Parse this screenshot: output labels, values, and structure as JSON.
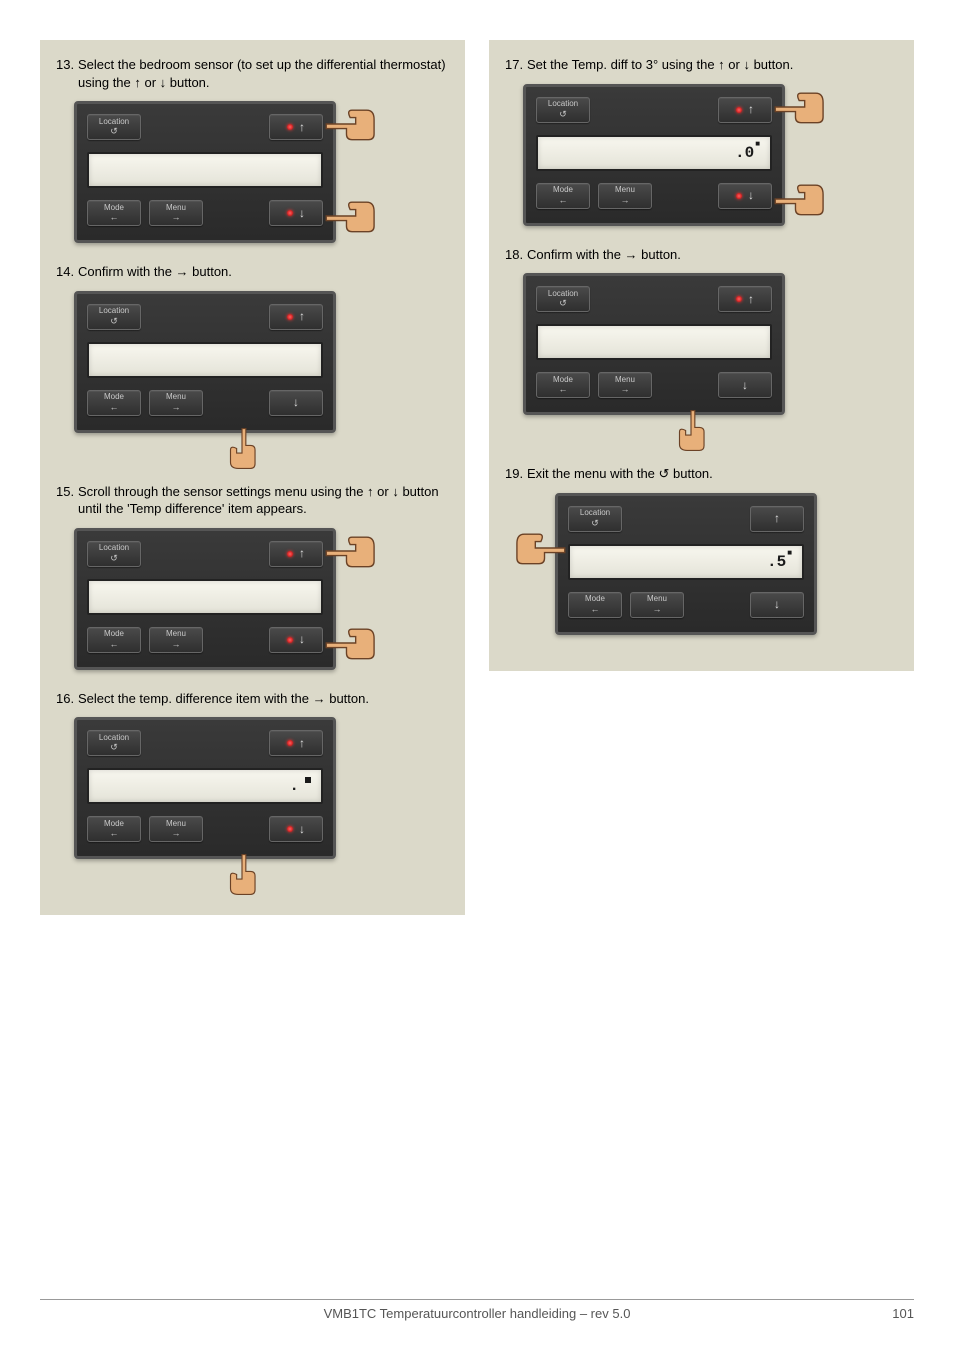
{
  "glyphs": {
    "up": "↑",
    "down": "↓",
    "right": "→",
    "left": "←",
    "reload": "↺"
  },
  "buttons": {
    "location": "Location",
    "mode": "Mode",
    "menu": "Menu"
  },
  "left_steps": [
    {
      "num": "13.",
      "text": "Select the bedroom sensor (to set up the differential thermostat) using the ↑ or ↓ button."
    },
    {
      "num": "14.",
      "text": "Confirm with the → button."
    },
    {
      "num": "15.",
      "text": "Scroll through the sensor settings menu using the ↑ or ↓ button until the 'Temp difference' item appears."
    },
    {
      "num": "16.",
      "text": "Select the temp. difference item with the → button."
    }
  ],
  "right_steps": [
    {
      "num": "17.",
      "text": "Set the Temp. diff to 3° using the ↑ or ↓ button."
    },
    {
      "num": "18.",
      "text": "Confirm with the → button."
    },
    {
      "num": "19.",
      "text": "Exit the menu with the ↺ button."
    }
  ],
  "lcd": {
    "step16": ".",
    "step17": ".0",
    "step19": ".5"
  },
  "footer": {
    "center": "VMB1TC Temperatuurcontroller handleiding – rev 5.0",
    "page": "101"
  }
}
